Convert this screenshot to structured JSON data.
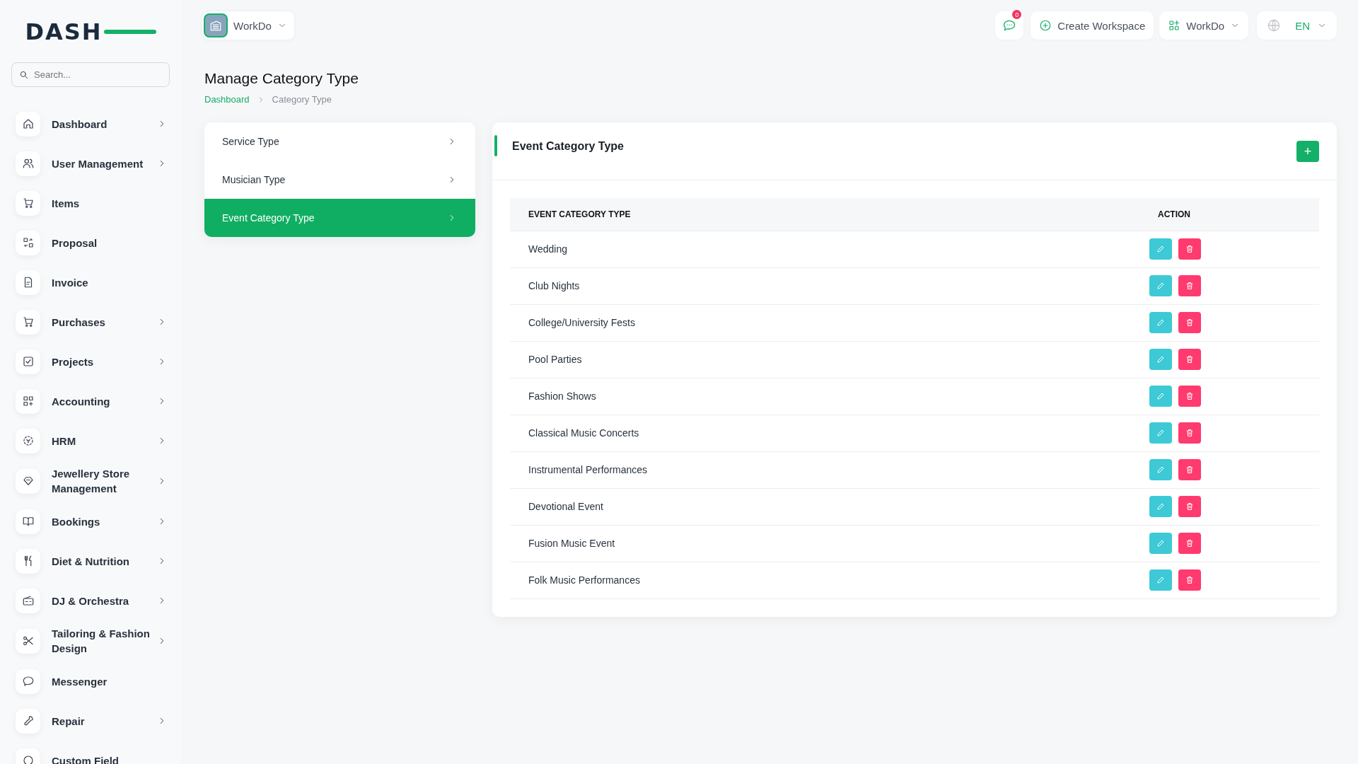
{
  "sidebar": {
    "logo": "DASH",
    "search": {
      "placeholder": "Search..."
    },
    "items": [
      {
        "label": "Dashboard",
        "expandable": true
      },
      {
        "label": "User Management",
        "expandable": true
      },
      {
        "label": "Items",
        "expandable": false
      },
      {
        "label": "Proposal",
        "expandable": false
      },
      {
        "label": "Invoice",
        "expandable": false
      },
      {
        "label": "Purchases",
        "expandable": true
      },
      {
        "label": "Projects",
        "expandable": true
      },
      {
        "label": "Accounting",
        "expandable": true
      },
      {
        "label": "HRM",
        "expandable": true
      },
      {
        "label": "Jewellery Store Management",
        "expandable": true
      },
      {
        "label": "Bookings",
        "expandable": true
      },
      {
        "label": "Diet & Nutrition",
        "expandable": true
      },
      {
        "label": "DJ & Orchestra",
        "expandable": true
      },
      {
        "label": "Tailoring & Fashion Design",
        "expandable": true
      },
      {
        "label": "Messenger",
        "expandable": false
      },
      {
        "label": "Repair",
        "expandable": true
      },
      {
        "label": "Custom Field",
        "expandable": false
      }
    ]
  },
  "topbar": {
    "workspace": {
      "label": "WorkDo"
    },
    "messages": {
      "badge": "0"
    },
    "create_workspace": {
      "label": "Create Workspace"
    },
    "workspace_menu": {
      "label": "WorkDo"
    },
    "language": {
      "label": "EN"
    }
  },
  "page": {
    "title": "Manage Category Type",
    "breadcrumb": [
      {
        "label": "Dashboard",
        "kind": "link"
      },
      {
        "label": "Category Type",
        "kind": "current"
      }
    ]
  },
  "category_tabs": [
    {
      "label": "Service Type",
      "selected": false
    },
    {
      "label": "Musician Type",
      "selected": false
    },
    {
      "label": "Event Category Type",
      "selected": true
    }
  ],
  "card": {
    "title": "Event Category Type",
    "add_button": {
      "label": "+"
    },
    "table": {
      "columns": [
        "EVENT CATEGORY TYPE",
        "ACTION"
      ],
      "rows": [
        {
          "name": "Wedding"
        },
        {
          "name": "Club Nights"
        },
        {
          "name": "College/University Fests"
        },
        {
          "name": "Pool Parties"
        },
        {
          "name": "Fashion Shows"
        },
        {
          "name": "Classical Music Concerts"
        },
        {
          "name": "Instrumental Performances"
        },
        {
          "name": "Devotional Event"
        },
        {
          "name": "Fusion Music Event"
        },
        {
          "name": "Folk Music Performances"
        }
      ]
    }
  }
}
